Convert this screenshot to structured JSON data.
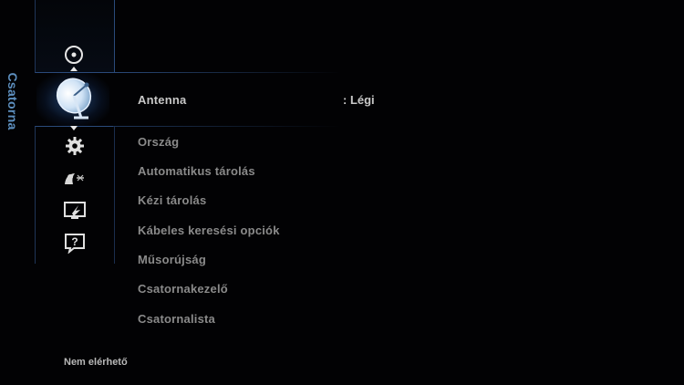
{
  "side_label": "Csatorna",
  "menu": {
    "selected": {
      "label": "Antenna",
      "value": ": Légi"
    },
    "items": [
      {
        "label": "Ország"
      },
      {
        "label": "Automatikus tárolás"
      },
      {
        "label": "Kézi tárolás"
      },
      {
        "label": "Kábeles keresési opciók"
      },
      {
        "label": "Műsorújság"
      },
      {
        "label": "Csatornakezelő"
      },
      {
        "label": "Csatornalista"
      }
    ]
  },
  "icons": [
    {
      "name": "picture-icon"
    },
    {
      "name": "satellite-dish-icon"
    },
    {
      "name": "gear-icon"
    },
    {
      "name": "support-icon"
    },
    {
      "name": "input-icon"
    },
    {
      "name": "help-icon"
    }
  ],
  "status_text": "Nem elérhető",
  "colors": {
    "accent": "#5d8fbf",
    "frame": "#2a4a7a",
    "text_dim": "#8a8a8a",
    "text_selected": "#c8c8c8"
  }
}
